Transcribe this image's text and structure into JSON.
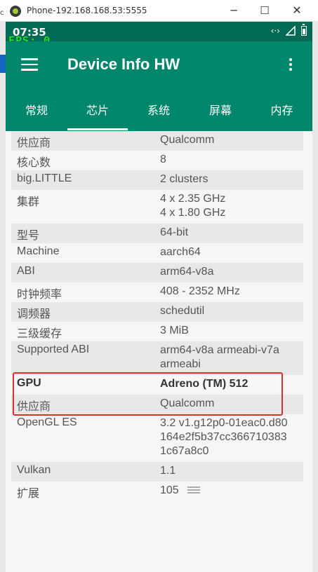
{
  "window": {
    "title": "Phone-192.168.168.53:5555",
    "side_text": "c",
    "minimize_glyph": "─",
    "maximize_glyph": "☐",
    "close_glyph": "✕"
  },
  "status_bar": {
    "time": "07:35",
    "fps": "FPS: 0",
    "icons": [
      "code-arrows-icon",
      "signal-icon",
      "battery-icon"
    ],
    "arrows_glyph": "‹·›"
  },
  "app_bar": {
    "title": "Device Info HW",
    "color": "#00876b",
    "status_color": "#006a55"
  },
  "tabs": [
    {
      "label": "常规",
      "active": false
    },
    {
      "label": "芯片",
      "active": true
    },
    {
      "label": "系统",
      "active": false
    },
    {
      "label": "屏幕",
      "active": false
    },
    {
      "label": "内存",
      "active": false
    }
  ],
  "rows": [
    {
      "key": "供应商",
      "value": "Qualcomm"
    },
    {
      "key": "核心数",
      "value": "8"
    },
    {
      "key": "big.LITTLE",
      "value": "2 clusters"
    },
    {
      "key": "集群",
      "value_lines": [
        "4 x 2.35 GHz",
        "4 x 1.80 GHz"
      ]
    },
    {
      "key": "型号",
      "value": "64-bit"
    },
    {
      "key": "Machine",
      "value": "aarch64"
    },
    {
      "key": "ABI",
      "value": "arm64-v8a"
    },
    {
      "key": "时钟频率",
      "value": "408 - 2352 MHz"
    },
    {
      "key": "调频器",
      "value": "schedutil"
    },
    {
      "key": "三级缓存",
      "value": "3 MiB"
    },
    {
      "key": "Supported ABI",
      "value_lines": [
        "arm64-v8a armeabi-v7a",
        "armeabi"
      ]
    },
    {
      "key": "GPU",
      "value": "Adreno (TM) 512"
    },
    {
      "key": "供应商",
      "value": "Qualcomm"
    },
    {
      "key": "OpenGL ES",
      "value_lines": [
        "3.2 v1.g12p0-01eac0.d80",
        "164e2f5b37cc366710383",
        "1c67a8c0"
      ]
    },
    {
      "key": "Vulkan",
      "value": "1.1"
    },
    {
      "key": "扩展",
      "value": "105"
    }
  ],
  "highlight_color": "#e0302a"
}
